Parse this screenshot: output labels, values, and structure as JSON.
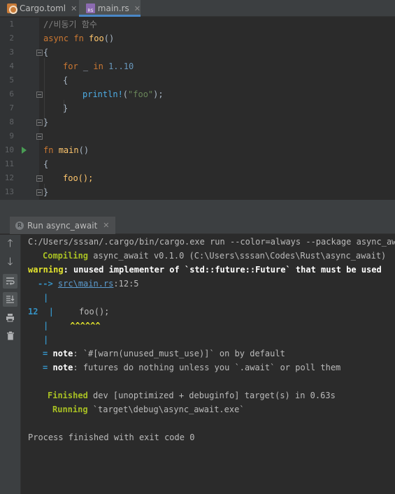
{
  "tabs": [
    {
      "label": "Cargo.toml",
      "icon": "toml-file-icon",
      "active": false
    },
    {
      "label": "main.rs",
      "icon": "rust-file-icon",
      "active": true
    }
  ],
  "editor": {
    "line_numbers": [
      "1",
      "2",
      "3",
      "4",
      "5",
      "6",
      "7",
      "8",
      "9",
      "10",
      "11",
      "12",
      "13"
    ],
    "lines": {
      "l1": {
        "comment": "//비동기 함수"
      },
      "l2": {
        "kw": "async fn",
        "name": "foo",
        "rest": "()"
      },
      "l3": {
        "brace": "{"
      },
      "l4": {
        "kw_for": "for",
        "var": " _ ",
        "kw_in": "in",
        "range": "1..10"
      },
      "l5": {
        "brace": "{"
      },
      "l6": {
        "macro": "println!",
        "open": "(",
        "str": "\"foo\"",
        "close": ");"
      },
      "l7": {
        "brace": "}"
      },
      "l8": {
        "brace": "}"
      },
      "l10": {
        "kw": "fn",
        "name": "main",
        "rest": "()"
      },
      "l11": {
        "brace": "{"
      },
      "l12": {
        "call": "foo();"
      },
      "l13": {
        "brace": "}"
      }
    }
  },
  "run_panel": {
    "tab_label": "Run async_await",
    "toolbar_icons": [
      "up-arrow-icon",
      "down-arrow-icon",
      "soft-wrap-icon",
      "scroll-to-end-icon",
      "print-icon",
      "trash-icon"
    ],
    "console": {
      "command": "C:/Users/sssan/.cargo/bin/cargo.exe run --color=always --package async_await --bin async_await",
      "compiling_label": "Compiling",
      "compiling_text": " async_await v0.1.0 (C:\\Users\\sssan\\Codes\\Rust\\async_await)",
      "warning_label": "warning",
      "warning_text": ": unused implementer of `std::future::Future` that must be used",
      "arrow": "-->",
      "location_link": "src\\main.rs",
      "location_rest": ":12:5",
      "pipe": "|",
      "code_line_no": "12",
      "code_line_text": "     foo();",
      "carets": "^^^^^^",
      "note_eq": "=",
      "note_label": "note",
      "note1_text": ": `#[warn(unused_must_use)]` on by default",
      "note2_text": ": futures do nothing unless you `.await` or poll them",
      "finished_label": "Finished",
      "finished_text": " dev [unoptimized + debuginfo] target(s) in 0.63s",
      "running_label": "Running",
      "running_text": " `target\\debug\\async_await.exe`",
      "exit_text": "Process finished with exit code 0"
    }
  },
  "colors": {
    "accent": "#4a88c7",
    "keyword": "#cc7832",
    "function": "#ffc66d",
    "string": "#6a8759",
    "number": "#6897bb"
  }
}
